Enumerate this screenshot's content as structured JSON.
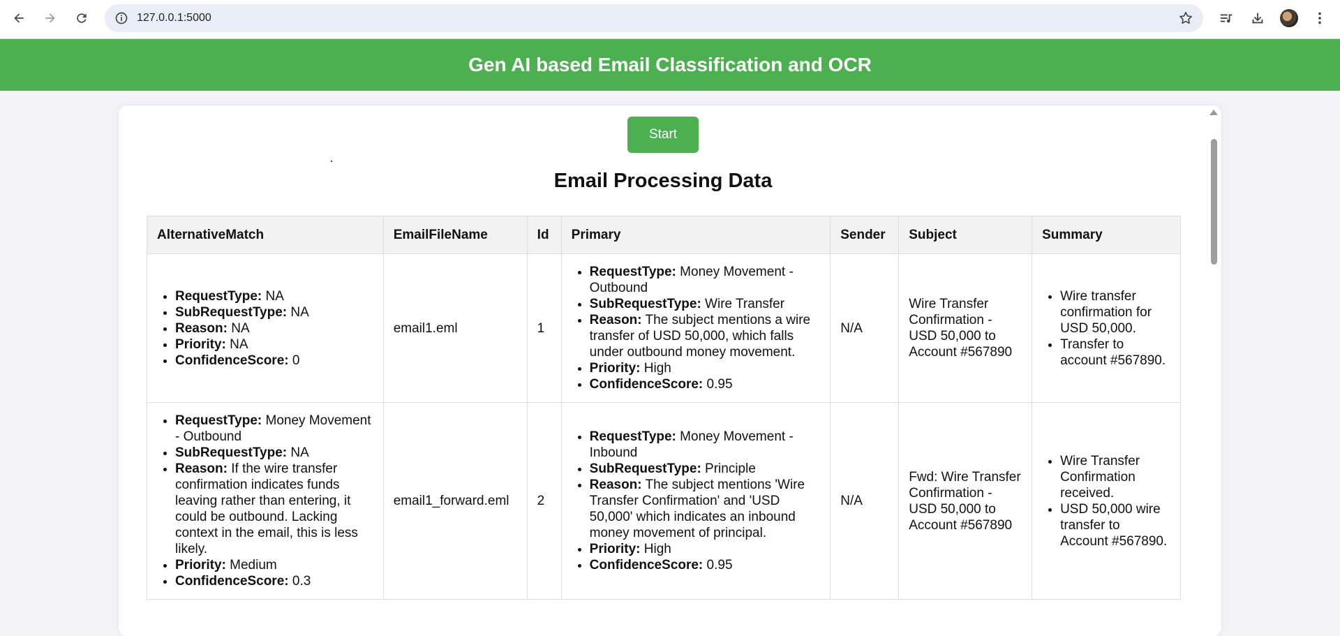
{
  "browser": {
    "url": "127.0.0.1:5000"
  },
  "header": {
    "title": "Gen AI based Email Classification and OCR"
  },
  "main": {
    "start_label": "Start",
    "section_title": "Email Processing Data",
    "columns": [
      "AlternativeMatch",
      "EmailFileName",
      "Id",
      "Primary",
      "Sender",
      "Subject",
      "Summary"
    ],
    "rows": [
      {
        "alternative": [
          {
            "key": "RequestType:",
            "value": " NA"
          },
          {
            "key": "SubRequestType:",
            "value": " NA"
          },
          {
            "key": "Reason:",
            "value": " NA"
          },
          {
            "key": "Priority:",
            "value": " NA"
          },
          {
            "key": "ConfidenceScore:",
            "value": " 0"
          }
        ],
        "file": "email1.eml",
        "id": "1",
        "primary": [
          {
            "key": "RequestType:",
            "value": " Money Movement - Outbound"
          },
          {
            "key": "SubRequestType:",
            "value": " Wire Transfer"
          },
          {
            "key": "Reason:",
            "value": " The subject mentions a wire transfer of USD 50,000, which falls under outbound money movement."
          },
          {
            "key": "Priority:",
            "value": " High"
          },
          {
            "key": "ConfidenceScore:",
            "value": " 0.95"
          }
        ],
        "sender": "N/A",
        "subject": "Wire Transfer Confirmation - USD 50,000 to Account #567890",
        "summary": [
          "Wire transfer confirmation for USD 50,000.",
          "Transfer to account #567890."
        ]
      },
      {
        "alternative": [
          {
            "key": "RequestType:",
            "value": " Money Movement - Outbound"
          },
          {
            "key": "SubRequestType:",
            "value": " NA"
          },
          {
            "key": "Reason:",
            "value": " If the wire transfer confirmation indicates funds leaving rather than entering, it could be outbound. Lacking context in the email, this is less likely."
          },
          {
            "key": "Priority:",
            "value": " Medium"
          },
          {
            "key": "ConfidenceScore:",
            "value": " 0.3"
          }
        ],
        "file": "email1_forward.eml",
        "id": "2",
        "primary": [
          {
            "key": "RequestType:",
            "value": " Money Movement - Inbound"
          },
          {
            "key": "SubRequestType:",
            "value": " Principle"
          },
          {
            "key": "Reason:",
            "value": " The subject mentions 'Wire Transfer Confirmation' and 'USD 50,000' which indicates an inbound money movement of principal."
          },
          {
            "key": "Priority:",
            "value": " High"
          },
          {
            "key": "ConfidenceScore:",
            "value": " 0.95"
          }
        ],
        "sender": "N/A",
        "subject": "Fwd: Wire Transfer Confirmation - USD 50,000 to Account #567890",
        "summary": [
          "Wire Transfer Confirmation received.",
          "USD 50,000 wire transfer to Account #567890."
        ]
      }
    ]
  },
  "icons": {
    "back": "back-arrow-icon",
    "forward": "forward-arrow-icon",
    "reload": "reload-icon",
    "info": "info-icon",
    "star": "star-icon",
    "media": "media-control-icon",
    "download": "download-icon",
    "menu": "more-vert-icon"
  },
  "colors": {
    "header_green": "#4caf50",
    "button_green": "#4caf50",
    "page_bg": "#f3f3f7"
  }
}
